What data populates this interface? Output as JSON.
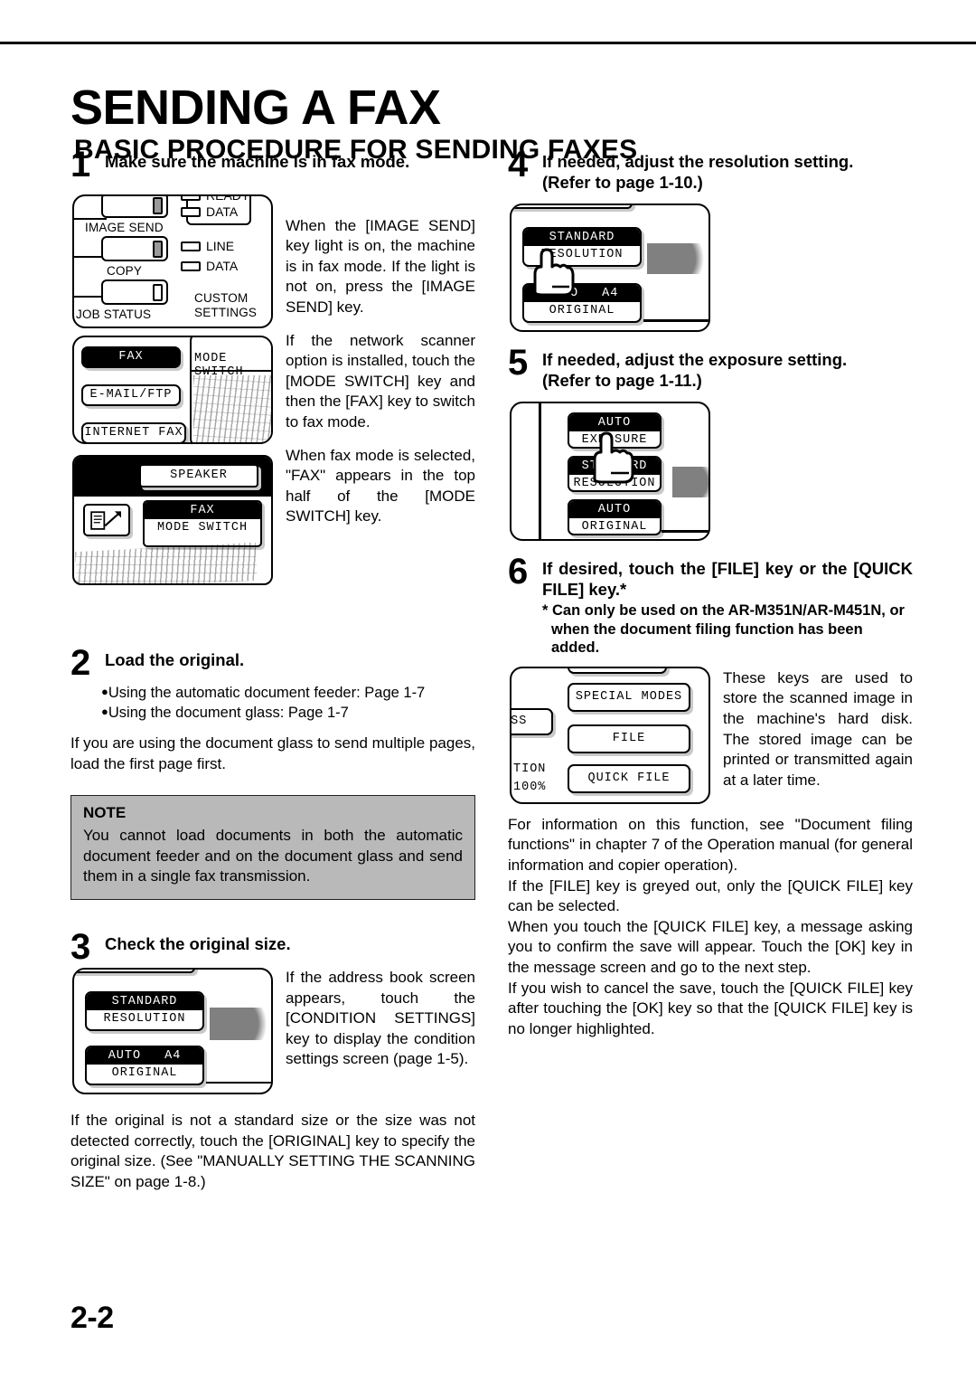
{
  "page": {
    "chapter_title": "SENDING A FAX",
    "section_title": "BASIC PROCEDURE FOR SENDING FAXES",
    "page_number": "2-2"
  },
  "steps": {
    "s1": {
      "number": "1",
      "title": "Make sure the machine is in fax mode.",
      "paragraphs": [
        "When the [IMAGE SEND] key light is on, the machine is in fax mode. If the light is not on, press the [IMAGE SEND] key.",
        "If the network scanner option is installed, touch the [MODE SWITCH] key and then the [FAX] key to switch to fax mode.",
        "When fax mode is selected, \"FAX\" appears in the top half of the [MODE SWITCH] key."
      ]
    },
    "s2": {
      "number": "2",
      "title": "Load the original.",
      "bullets": [
        "Using the automatic document feeder: Page 1-7",
        "Using the document glass: Page 1-7"
      ],
      "paragraph": "If you are using the document glass to send multiple pages, load the first page first."
    },
    "note": {
      "title": "NOTE",
      "body": "You cannot load documents in both the automatic document feeder and on the document glass and send them in a single fax transmission."
    },
    "s3": {
      "number": "3",
      "title": "Check the original size.",
      "paragraph_side": "If the address book screen appears, touch the [CONDITION SETTINGS] key to display the condition settings screen (page 1-5).",
      "paragraph_below": "If the original is not a standard size or the size was not detected correctly, touch the [ORIGINAL] key to specify the original size. (See \"MANUALLY SETTING THE SCANNING SIZE\" on page 1-8.)"
    },
    "s4": {
      "number": "4",
      "title": "If needed, adjust the resolution setting.",
      "title2": "(Refer to page 1-10.)"
    },
    "s5": {
      "number": "5",
      "title": "If needed, adjust the exposure setting.",
      "title2": "(Refer to page 1-11.)"
    },
    "s6": {
      "number": "6",
      "title": "If desired, touch the [FILE] key or the [QUICK FILE] key.*",
      "footnote": "* Can only be used on the AR-M351N/AR-M451N, or when the document filing function has been added.",
      "paragraph_side": "These keys are used to store the scanned image in the machine's hard disk. The stored image can be printed or transmitted again at a later time.",
      "paragraphs_below": [
        "For information on this function, see \"Document filing functions\" in chapter 7 of the Operation manual (for general information and copier operation).",
        "If the [FILE] key is greyed out, only the [QUICK FILE] key can be selected.",
        "When you touch the [QUICK FILE] key, a message asking you to confirm the save will appear. Touch the [OK] key in the message screen and go to the next step.",
        "If you wish to cancel the save, touch the [QUICK FILE] key after touching the [OK] key so that the [QUICK FILE] key is no longer highlighted."
      ]
    }
  },
  "illustrations": {
    "operation_panel": {
      "keys": [
        {
          "label": "IMAGE SEND",
          "lit": "on"
        },
        {
          "label": "COPY",
          "lit": "off"
        },
        {
          "label": "JOB STATUS",
          "lit": "off"
        }
      ],
      "leds": [
        "READY",
        "DATA",
        "LINE",
        "DATA"
      ],
      "custom_settings": "CUSTOM\nSETTINGS",
      "custom_settings_line1": "CUSTOM",
      "custom_settings_line2": "SETTINGS"
    },
    "mode_switch_panel": {
      "keys": [
        "FAX",
        "E-MAIL/FTP",
        "INTERNET FAX"
      ],
      "selected": "FAX",
      "header": "MODE SWITCH"
    },
    "speaker_panel": {
      "speaker": "SPEAKER",
      "mode_top": "FAX",
      "mode_bottom": "MODE SWITCH"
    },
    "size_panel": {
      "key1_top": "STANDARD",
      "key1_bottom": "RESOLUTION",
      "key2_top_left": "AUTO",
      "key2_top_right": "A4",
      "key2_bottom": "ORIGINAL"
    },
    "resolution_panel": {
      "key1_top": "STANDARD",
      "key1_bottom": "RESOLUTION",
      "key2_top_left": "AUTO",
      "key2_top_right": "A4",
      "key2_bottom": "ORIGINAL"
    },
    "exposure_panel": {
      "key1_top": "AUTO",
      "key1_bottom": "EXPOSURE",
      "key2_top": "STANDARD",
      "key2_bottom": "RESOLUTION",
      "key3_top": "AUTO",
      "key3_bottom": "ORIGINAL"
    },
    "file_panel": {
      "key1": "SPECIAL MODES",
      "key2": "FILE",
      "key3": "QUICK FILE",
      "side1": "ESS",
      "side2": "TION",
      "side3": "100%"
    }
  }
}
